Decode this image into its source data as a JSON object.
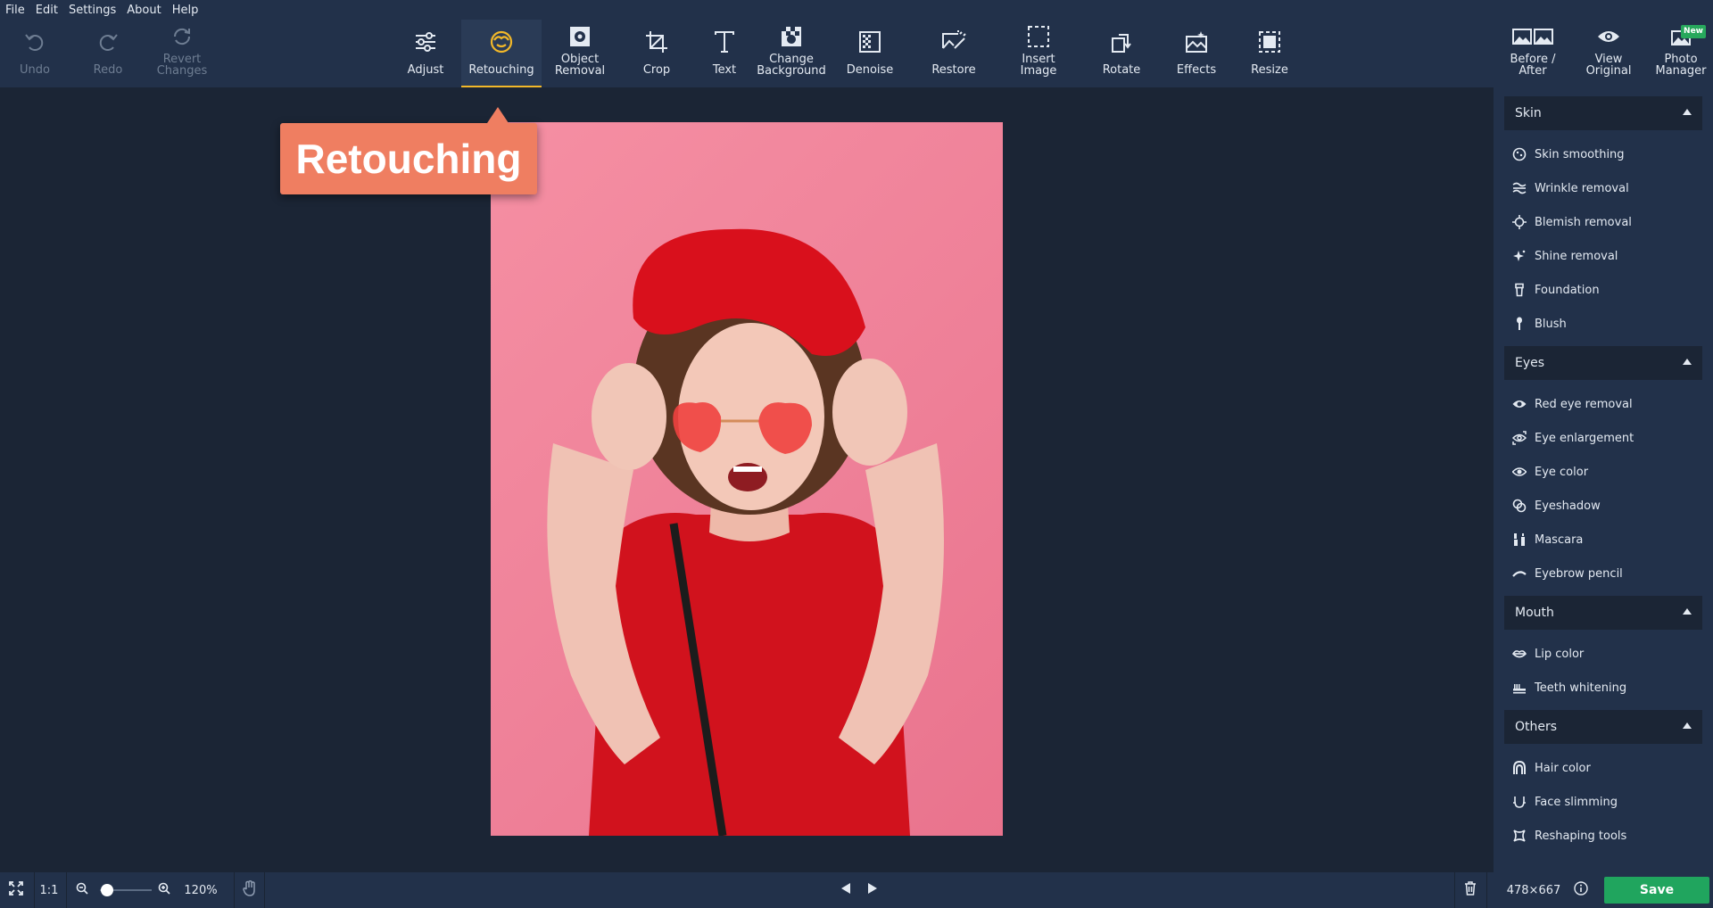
{
  "menu": [
    "File",
    "Edit",
    "Settings",
    "About",
    "Help"
  ],
  "toolbar": {
    "undo": "Undo",
    "redo": "Redo",
    "revert": "Revert\nChanges",
    "tools": [
      {
        "label": "Adjust",
        "icon": "sliders-icon"
      },
      {
        "label": "Retouching",
        "icon": "retouch-face-icon",
        "active": true
      },
      {
        "label": "Object\nRemoval",
        "icon": "object-removal-icon"
      },
      {
        "label": "Crop",
        "icon": "crop-icon"
      },
      {
        "label": "Text",
        "icon": "text-icon"
      },
      {
        "label": "Change\nBackground",
        "icon": "change-background-icon"
      },
      {
        "label": "Denoise",
        "icon": "denoise-icon"
      },
      {
        "label": "Restore",
        "icon": "restore-icon"
      },
      {
        "label": "Insert\nImage",
        "icon": "insert-image-icon"
      },
      {
        "label": "Rotate",
        "icon": "rotate-icon"
      },
      {
        "label": "Effects",
        "icon": "effects-icon"
      },
      {
        "label": "Resize",
        "icon": "resize-icon"
      }
    ],
    "before_after": "Before /\nAfter",
    "view_original": "View\nOriginal",
    "photo_manager": "Photo\nManager",
    "new_badge": "New"
  },
  "tooltip": "Retouching",
  "panel": {
    "sections": [
      {
        "title": "Skin",
        "items": [
          "Skin smoothing",
          "Wrinkle removal",
          "Blemish removal",
          "Shine removal",
          "Foundation",
          "Blush"
        ]
      },
      {
        "title": "Eyes",
        "items": [
          "Red eye removal",
          "Eye enlargement",
          "Eye color",
          "Eyeshadow",
          "Mascara",
          "Eyebrow pencil"
        ]
      },
      {
        "title": "Mouth",
        "items": [
          "Lip color",
          "Teeth whitening"
        ]
      },
      {
        "title": "Others",
        "items": [
          "Hair color",
          "Face slimming",
          "Reshaping tools"
        ]
      }
    ]
  },
  "bottom": {
    "ratio": "1:1",
    "zoom": "120%",
    "dimensions": "478×667",
    "save": "Save"
  },
  "colors": {
    "accent": "#f2b829",
    "save": "#20a55e",
    "tooltip": "#ef7e61"
  }
}
